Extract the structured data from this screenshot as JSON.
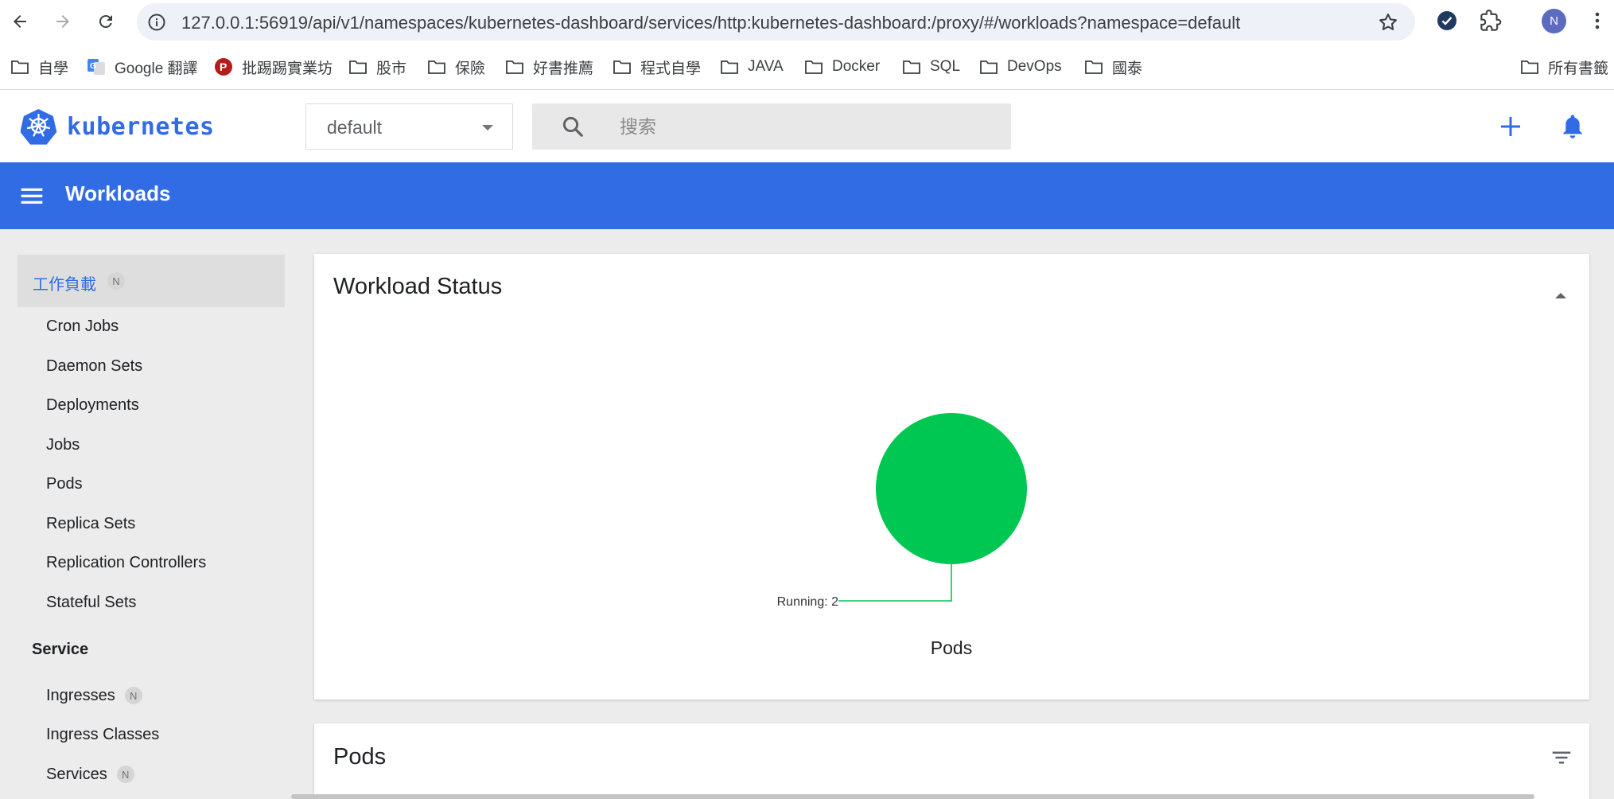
{
  "browser": {
    "url": "127.0.0.1:56919/api/v1/namespaces/kubernetes-dashboard/services/http:kubernetes-dashboard:/proxy/#/workloads?namespace=default",
    "profile_initial": "N",
    "bookmarks": [
      {
        "label": "自學",
        "icon": "folder-icon"
      },
      {
        "label": "Google 翻譯",
        "icon": "google-translate-icon"
      },
      {
        "label": "批踢踢實業坊",
        "icon": "ptt-icon"
      },
      {
        "label": "股市",
        "icon": "folder-icon"
      },
      {
        "label": "保險",
        "icon": "folder-icon"
      },
      {
        "label": "好書推薦",
        "icon": "folder-icon"
      },
      {
        "label": "程式自學",
        "icon": "folder-icon"
      },
      {
        "label": "JAVA",
        "icon": "folder-icon"
      },
      {
        "label": "Docker",
        "icon": "folder-icon"
      },
      {
        "label": "SQL",
        "icon": "folder-icon"
      },
      {
        "label": "DevOps",
        "icon": "folder-icon"
      },
      {
        "label": "國泰",
        "icon": "folder-icon"
      }
    ],
    "all_bookmarks_label": "所有書籤"
  },
  "header": {
    "logo_text": "kubernetes",
    "namespace": "default",
    "search_placeholder": "搜索"
  },
  "toolbar": {
    "title": "Workloads"
  },
  "sidebar": {
    "active": {
      "label": "工作負載",
      "badge": "N"
    },
    "workload_items": [
      {
        "label": "Cron Jobs"
      },
      {
        "label": "Daemon Sets"
      },
      {
        "label": "Deployments"
      },
      {
        "label": "Jobs"
      },
      {
        "label": "Pods"
      },
      {
        "label": "Replica Sets"
      },
      {
        "label": "Replication Controllers"
      },
      {
        "label": "Stateful Sets"
      }
    ],
    "service_section": "Service",
    "service_items": [
      {
        "label": "Ingresses",
        "badge": "N"
      },
      {
        "label": "Ingress Classes"
      },
      {
        "label": "Services",
        "badge": "N"
      }
    ]
  },
  "main": {
    "workload_status_title": "Workload Status",
    "pods_card_title": "Pods"
  },
  "colors": {
    "brand": "#326ce5",
    "running": "#00c752"
  },
  "chart_data": {
    "type": "pie",
    "title": "Pods",
    "slices": [
      {
        "label": "Running",
        "value": 2,
        "color": "#00c752"
      }
    ],
    "annotation": "Running: 2"
  }
}
